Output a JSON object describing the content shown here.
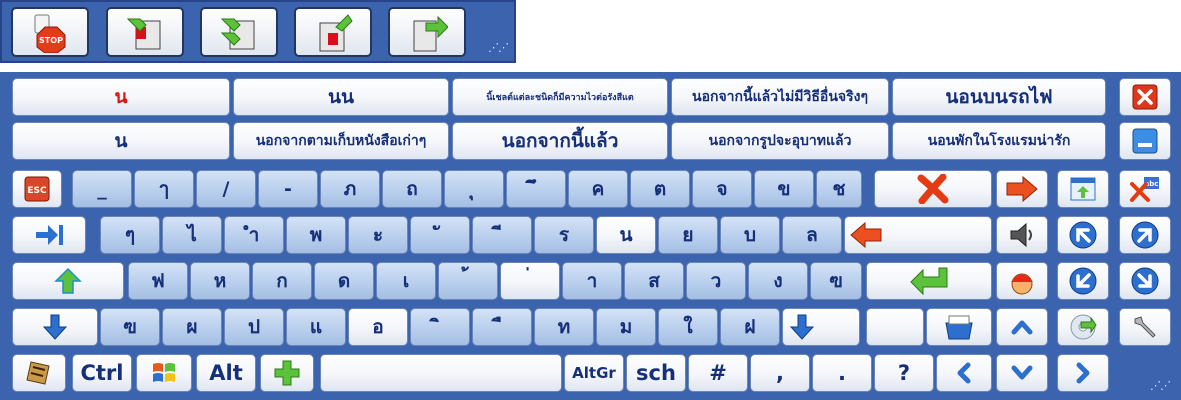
{
  "toolbar": {
    "buttons": [
      {
        "icon": "stop-icon",
        "label": "STOP"
      },
      {
        "icon": "move-left-window-icon"
      },
      {
        "icon": "move-both-window-icon"
      },
      {
        "icon": "move-up-window-icon"
      },
      {
        "icon": "move-right-window-icon"
      }
    ]
  },
  "suggestions": {
    "row1": [
      "น",
      "นน",
      "นิ้เชลต์แต่ละชนิดก็มีความไวต่อรังสีแต",
      "นอกจากนี้แล้วไม่มีวิธีอื่นจริงๆ",
      "นอนบนรถไฟ"
    ],
    "row2": [
      "น",
      "นอกจากตามเก็บหนังสือเก่าๆ",
      "นอกจากนี้แล้ว",
      "นอกจากรูปจะอุบาทแล้ว",
      "นอนพักในโรงแรมน่ารัก"
    ]
  },
  "keys": {
    "esc": "ESC",
    "row1": [
      "_",
      "ๅ",
      "/",
      "-",
      "ภ",
      "ถ",
      "ุ",
      "ึ",
      "ค",
      "ต",
      "จ",
      "ข",
      "ช"
    ],
    "row2": [
      "ๆ",
      "ไ",
      "ำ",
      "พ",
      "ะ",
      "ั",
      "ี",
      "ร",
      "น",
      "ย",
      "บ",
      "ล"
    ],
    "row3": [
      "ฟ",
      "ห",
      "ก",
      "ด",
      "เ",
      "้",
      "่",
      "า",
      "ส",
      "ว",
      "ง",
      "ฃ"
    ],
    "row4": [
      "ฃ",
      "ผ",
      "ป",
      "แ",
      "อ",
      "ิ",
      "ื",
      "ท",
      "ม",
      "ใ",
      "ฝ"
    ],
    "bottom": {
      "ctrl": "Ctrl",
      "alt": "Alt",
      "altgr": "AltGr",
      "sch": "sch",
      "hash": "#",
      "comma": ",",
      "period": ".",
      "question": "?"
    }
  },
  "icons": {
    "close": "close-icon",
    "minimize": "minimize-icon",
    "backspace": "delete-x-icon",
    "spellcheck": "spellcheck-icon",
    "settings": "wrench-icon"
  },
  "colors": {
    "frame": "#3c63ad",
    "key_text": "#152f78",
    "accent_red": "#d51616",
    "arrow_green": "#5cc23b",
    "arrow_blue": "#2d6fcf"
  }
}
